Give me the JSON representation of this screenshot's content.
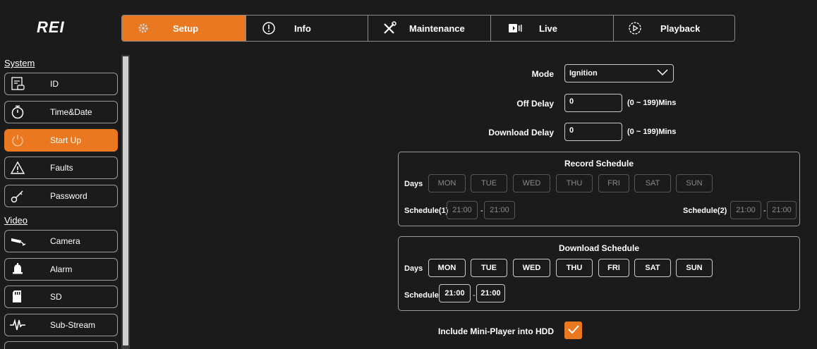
{
  "logo": "REI",
  "nav": {
    "tabs": [
      {
        "label": "Setup",
        "icon": "gear-icon",
        "active": true
      },
      {
        "label": "Info",
        "icon": "info-icon",
        "active": false
      },
      {
        "label": "Maintenance",
        "icon": "tools-icon",
        "active": false
      },
      {
        "label": "Live",
        "icon": "video-camera-icon",
        "active": false
      },
      {
        "label": "Playback",
        "icon": "play-circle-icon",
        "active": false
      }
    ]
  },
  "sidebar": {
    "system_title": "System",
    "video_title": "Video",
    "system_items": [
      {
        "label": "ID",
        "icon": "id-card-icon",
        "active": false
      },
      {
        "label": "Time&Date",
        "icon": "stopwatch-icon",
        "active": false
      },
      {
        "label": "Start Up",
        "icon": "power-icon",
        "active": true
      },
      {
        "label": "Faults",
        "icon": "warning-icon",
        "active": false
      },
      {
        "label": "Password",
        "icon": "key-icon",
        "active": false
      }
    ],
    "video_items": [
      {
        "label": "Camera",
        "icon": "security-camera-icon",
        "active": false
      },
      {
        "label": "Alarm",
        "icon": "alarm-bell-icon",
        "active": false
      },
      {
        "label": "SD",
        "icon": "sd-card-icon",
        "active": false
      },
      {
        "label": "Sub-Stream",
        "icon": "waveform-icon",
        "active": false
      }
    ]
  },
  "form": {
    "mode_label": "Mode",
    "mode_value": "Ignition",
    "off_delay_label": "Off Delay",
    "off_delay_value": "0",
    "off_delay_hint": "(0 ~ 199)Mins",
    "download_delay_label": "Download Delay",
    "download_delay_value": "0",
    "download_delay_hint": "(0 ~ 199)Mins"
  },
  "record_schedule": {
    "title": "Record Schedule",
    "days_label": "Days",
    "days": [
      "MON",
      "TUE",
      "WED",
      "THU",
      "FRI",
      "SAT",
      "SUN"
    ],
    "schedule1_label": "Schedule(1)",
    "schedule1_start": "21:00",
    "schedule1_end": "21:00",
    "schedule2_label": "Schedule(2)",
    "schedule2_start": "21:00",
    "schedule2_end": "21:00",
    "separator": "-"
  },
  "download_schedule": {
    "title": "Download Schedule",
    "days_label": "Days",
    "days": [
      "MON",
      "TUE",
      "WED",
      "THU",
      "FRI",
      "SAT",
      "SUN"
    ],
    "schedule_label": "Schedule",
    "schedule_start": "21:00",
    "schedule_end": "21:00",
    "separator": "-"
  },
  "mini_player": {
    "label": "Include Mini-Player into HDD",
    "checked": true
  },
  "colors": {
    "accent": "#e97820",
    "background": "#1b1b1b",
    "border": "#9a9a9a"
  }
}
